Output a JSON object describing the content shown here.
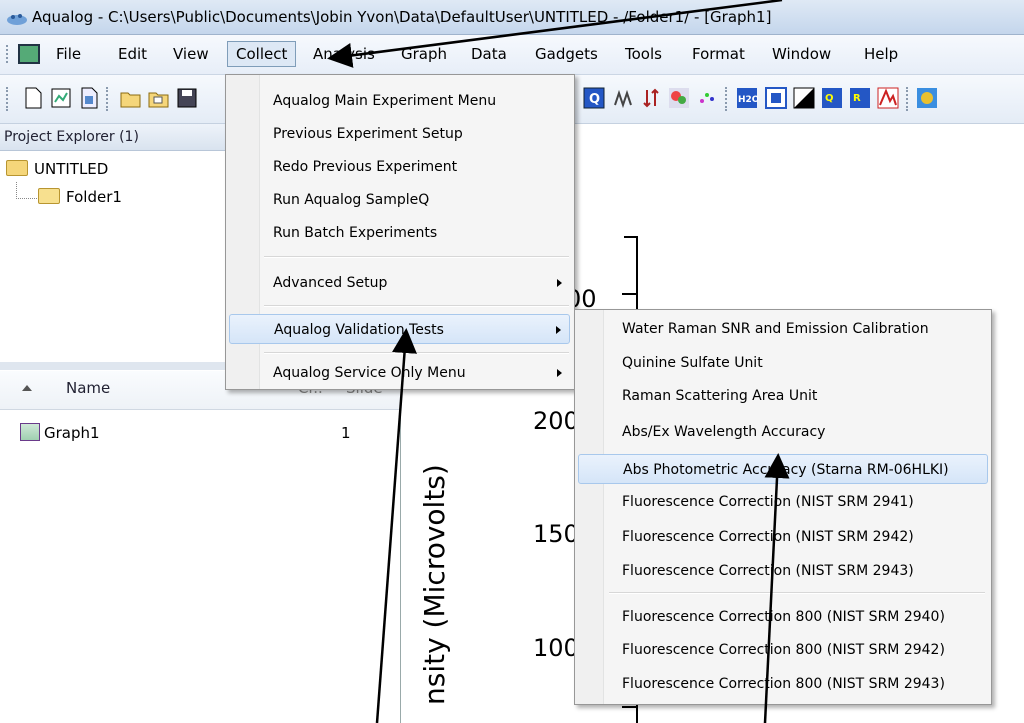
{
  "window": {
    "title": "Aqualog - C:\\Users\\Public\\Documents\\Jobin Yvon\\Data\\DefaultUser\\UNTITLED - /Folder1/ - [Graph1]"
  },
  "menubar": {
    "items": [
      "File",
      "Edit",
      "View",
      "Collect",
      "Analysis",
      "Graph",
      "Data",
      "Gadgets",
      "Tools",
      "Format",
      "Window",
      "Help"
    ],
    "active": "Collect"
  },
  "project_explorer": {
    "title": "Project Explorer (1)",
    "root": "UNTITLED",
    "child": "Folder1"
  },
  "file_list": {
    "columns": [
      "Name",
      "Cr..",
      "Slide"
    ],
    "rows": [
      {
        "name": "Graph1",
        "slide": "1"
      }
    ]
  },
  "graph": {
    "ylabel": "nsity (Microvolts)",
    "ticks": [
      "00",
      "200",
      "150",
      "100"
    ]
  },
  "collect_menu": {
    "items": [
      "Aqualog Main Experiment Menu",
      "Previous Experiment Setup",
      "Redo Previous Experiment",
      "Run Aqualog SampleQ",
      "Run Batch Experiments",
      "Advanced Setup",
      "Aqualog Validation Tests",
      "Aqualog Service Only Menu"
    ],
    "highlighted": "Aqualog Validation Tests"
  },
  "validation_submenu": {
    "items": [
      "Water Raman SNR and Emission Calibration",
      "Quinine Sulfate Unit",
      "Raman Scattering Area Unit",
      "Abs/Ex Wavelength Accuracy",
      "Abs Photometric Accuracy (Starna RM-06HLKI)",
      "Fluorescence Correction (NIST SRM 2941)",
      "Fluorescence Correction (NIST SRM 2942)",
      "Fluorescence Correction (NIST SRM 2943)",
      "Fluorescence Correction 800 (NIST SRM 2940)",
      "Fluorescence Correction 800 (NIST SRM 2942)",
      "Fluorescence Correction 800 (NIST SRM 2943)"
    ],
    "highlighted": "Abs Photometric Accuracy (Starna RM-06HLKI)"
  },
  "colors": {
    "menu_highlight": "#d5e5f8",
    "menu_bg": "#f5f5f5",
    "titlebar": "#c4d6ec"
  }
}
